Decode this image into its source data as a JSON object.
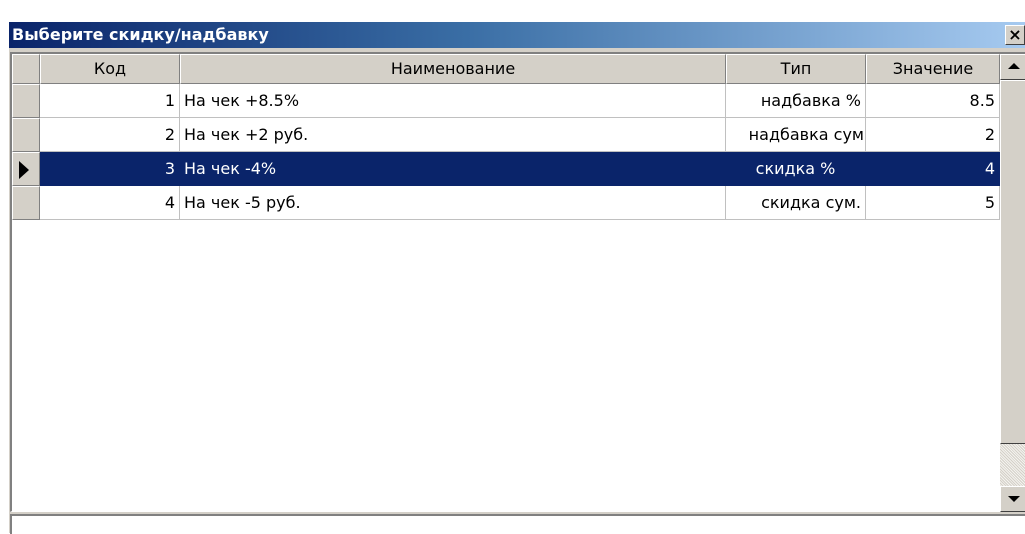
{
  "window": {
    "title": "Выберите скидку/надбавку",
    "close_glyph": "×",
    "close_icon": "close-icon"
  },
  "table": {
    "columns": [
      "Код",
      "Наименование",
      "Тип",
      "Значение"
    ],
    "rows": [
      {
        "code": "1",
        "name": "На чек +8.5%",
        "type": "надбавка %",
        "value": "8.5",
        "selected": false
      },
      {
        "code": "2",
        "name": "На чек +2 руб.",
        "type": "надбавка сум",
        "value": "2",
        "selected": false
      },
      {
        "code": "3",
        "name": "На чек -4%",
        "type": "скидка %",
        "value": "4",
        "selected": true
      },
      {
        "code": "4",
        "name": "На чек -5 руб.",
        "type": "скидка сум.",
        "value": "5",
        "selected": false
      }
    ],
    "selected_row_pointer_icon": "row-pointer-icon",
    "scroll_up_icon": "scroll-up-arrow-icon",
    "scroll_down_icon": "scroll-down-arrow-icon"
  },
  "colors": {
    "title_gradient_start": "#0a246a",
    "title_gradient_end": "#a6caf0",
    "selection": "#0a246a",
    "face": "#d4d0c8"
  }
}
